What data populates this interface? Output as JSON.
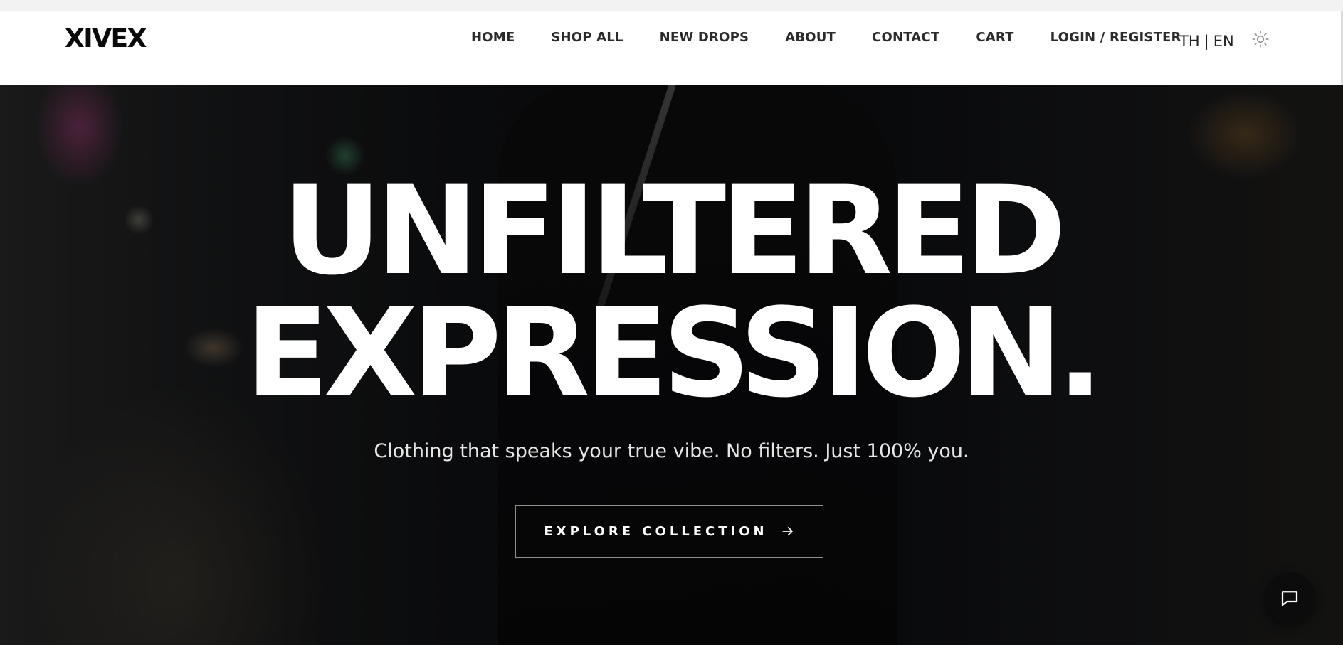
{
  "header": {
    "logo": "XIVEX",
    "nav": [
      "HOME",
      "SHOP ALL",
      "NEW DROPS",
      "ABOUT",
      "CONTACT",
      "CART",
      "LOGIN / REGISTER"
    ],
    "lang": {
      "th": "TH",
      "separator": "|",
      "en": "EN"
    },
    "theme_toggle_icon": "sun-icon"
  },
  "hero": {
    "headline_line1": "UNFILTERED",
    "headline_line2": "EXPRESSION.",
    "subtitle": "Clothing that speaks your true vibe. No filters. Just 100% you.",
    "cta_label": "EXPLORE COLLECTION",
    "cta_icon": "arrow-right-icon"
  },
  "chat": {
    "icon": "chat-bubble-icon"
  },
  "colors": {
    "header_bg": "#ffffff",
    "text_dark": "#0a0a0a",
    "hero_text": "#ffffff"
  }
}
